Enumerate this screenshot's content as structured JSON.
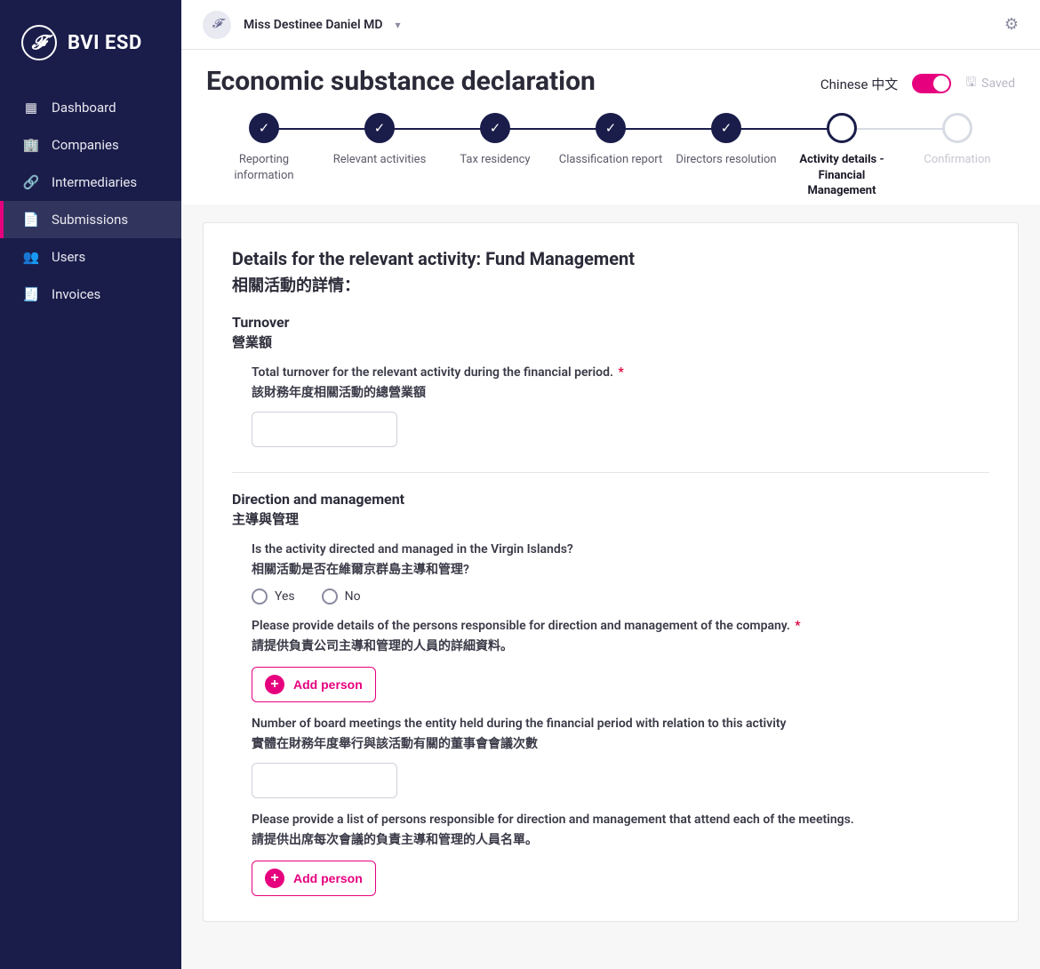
{
  "brand": "BVI ESD",
  "sidebar": {
    "items": [
      {
        "icon": "▦",
        "label": "Dashboard"
      },
      {
        "icon": "🏢",
        "label": "Companies"
      },
      {
        "icon": "🔗",
        "label": "Intermediaries"
      },
      {
        "icon": "📄",
        "label": "Submissions"
      },
      {
        "icon": "👥",
        "label": "Users"
      },
      {
        "icon": "🧾",
        "label": "Invoices"
      }
    ],
    "active_index": 3
  },
  "topbar": {
    "user_name": "Miss Destinee Daniel MD"
  },
  "page": {
    "title": "Economic substance declaration",
    "language_label": "Chinese 中文",
    "language_on": true,
    "saved_label": "Saved"
  },
  "stepper": [
    {
      "label": "Reporting information",
      "state": "done"
    },
    {
      "label": "Relevant activities",
      "state": "done"
    },
    {
      "label": "Tax residency",
      "state": "done"
    },
    {
      "label": "Classification report",
      "state": "done"
    },
    {
      "label": "Directors resolution",
      "state": "done"
    },
    {
      "label": "Activity details - Financial Management",
      "state": "current"
    },
    {
      "label": "Confirmation",
      "state": "future"
    }
  ],
  "form": {
    "heading_en": "Details for the relevant activity: Fund Management",
    "heading_zh": "相關活動的詳情：",
    "sections": {
      "turnover": {
        "title_en": "Turnover",
        "title_zh": "營業額",
        "q1_en": "Total turnover for the relevant activity during the financial period.",
        "q1_required": true,
        "q1_zh": "該財務年度相關活動的總營業額",
        "q1_value": ""
      },
      "direction": {
        "title_en": "Direction and management",
        "title_zh": "主導與管理",
        "q1_en": "Is the activity directed and managed in the Virgin Islands?",
        "q1_zh": "相關活動是否在維爾京群島主導和管理?",
        "q1_options": {
          "yes": "Yes",
          "no": "No"
        },
        "q1_value": null,
        "q2_en": "Please provide details of the persons responsible for direction and management of the company.",
        "q2_required": true,
        "q2_zh": "請提供負責公司主導和管理的人員的詳細資料。",
        "add_person_label": "Add person",
        "q3_en": "Number of board meetings the entity held during the financial period with relation to this activity",
        "q3_zh": "實體在財務年度舉行與該活動有關的董事會會議次數",
        "q3_value": "",
        "q4_en": "Please provide a list of persons responsible for direction and management that attend each of the meetings.",
        "q4_zh": "請提供出席每次會議的負責主導和管理的人員名單。"
      }
    }
  }
}
